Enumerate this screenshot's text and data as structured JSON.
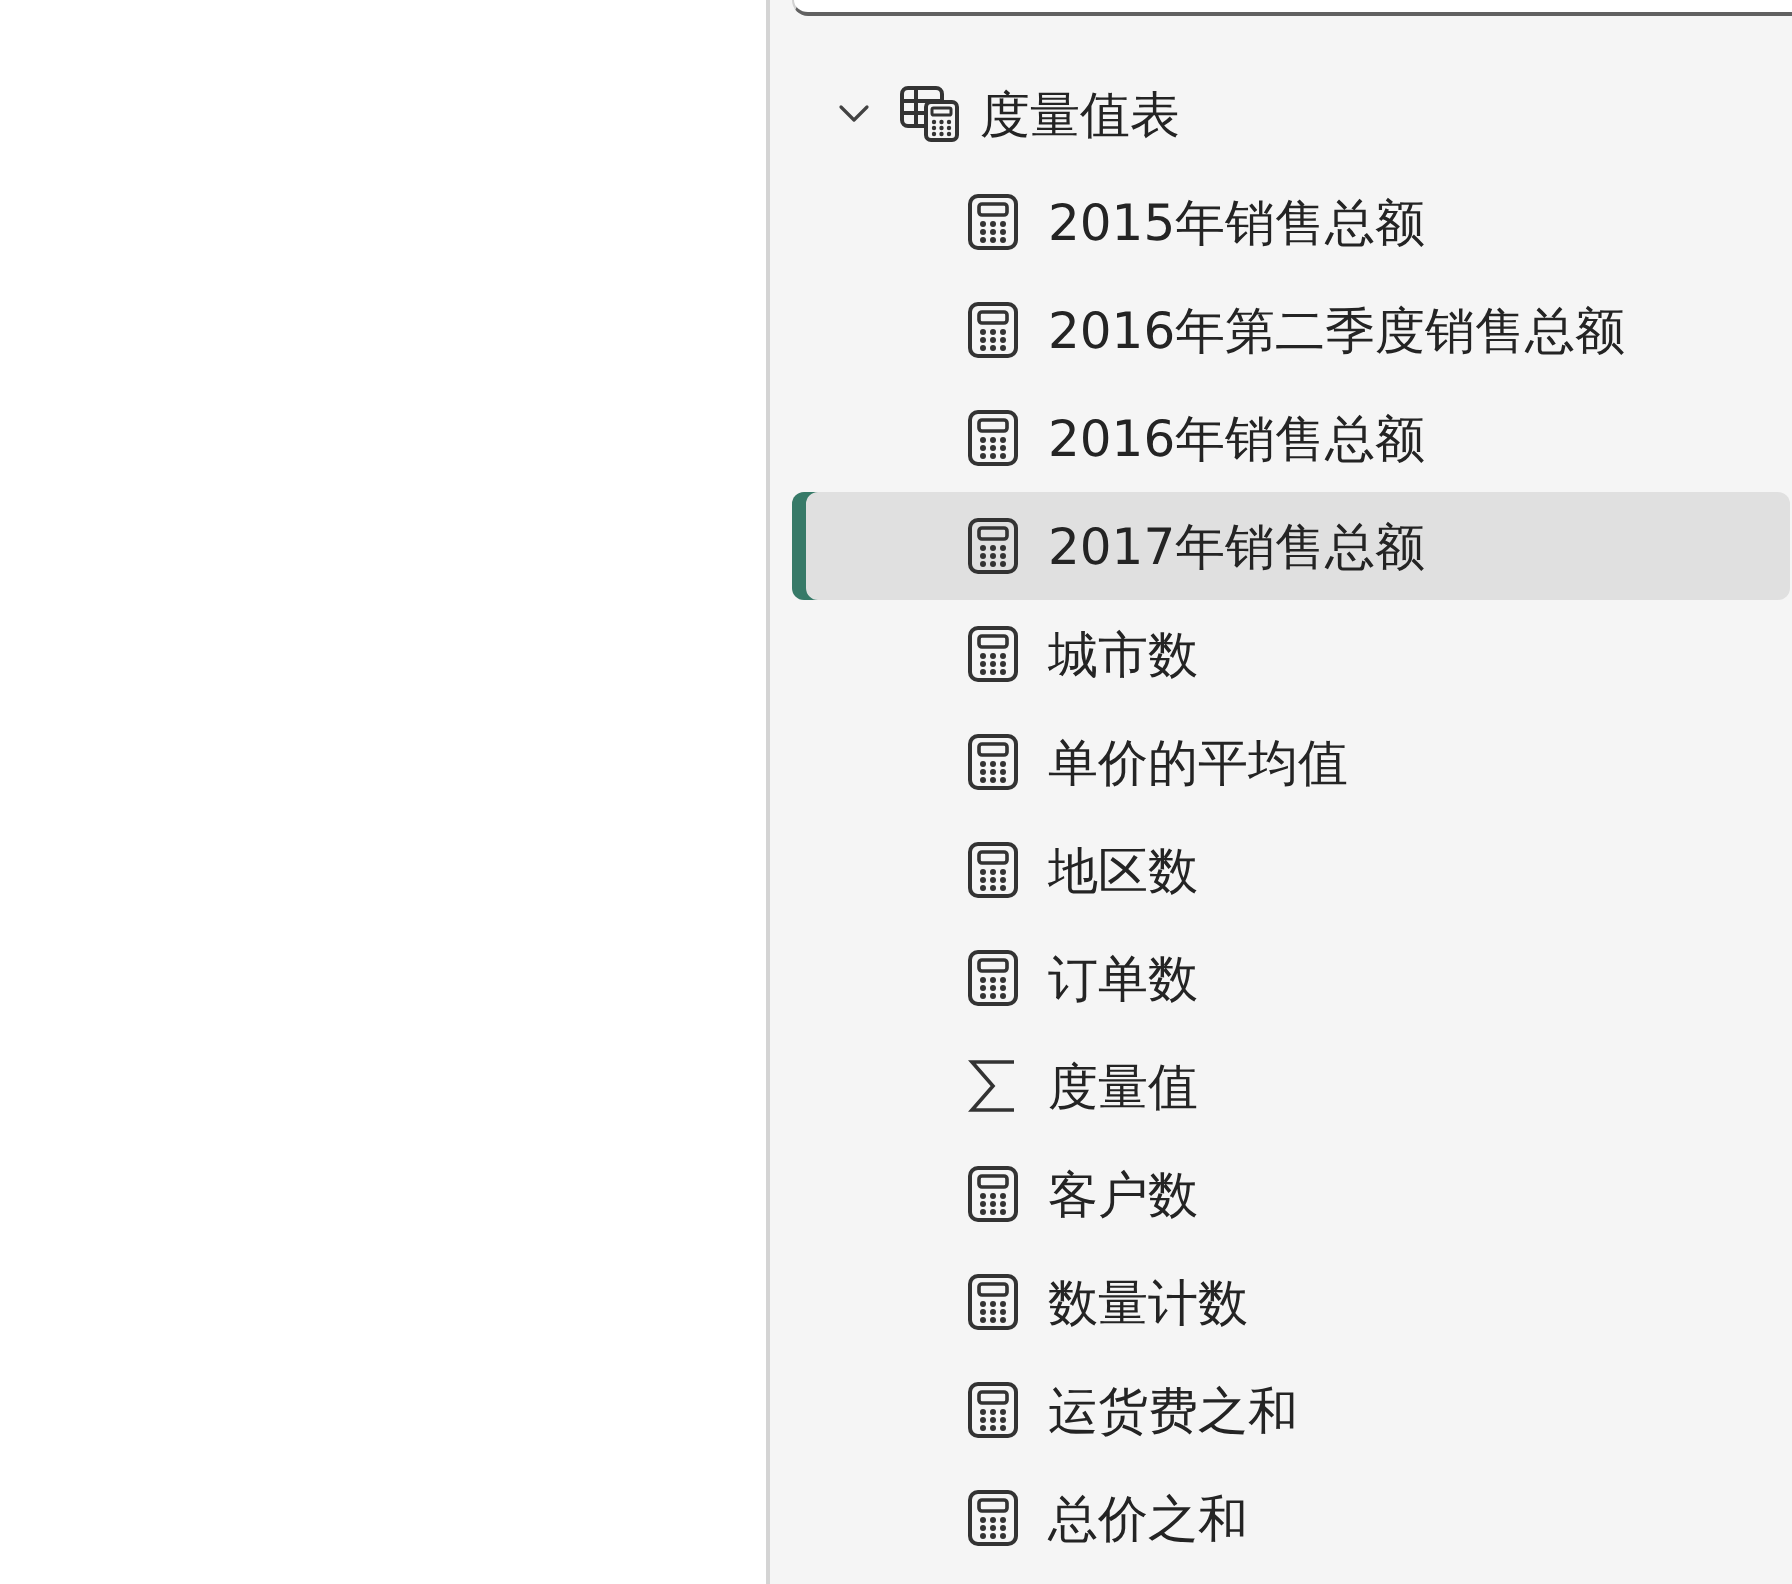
{
  "tree": {
    "label": "度量值表",
    "expanded": true,
    "children": [
      {
        "label": "2015年销售总额",
        "kind": "measure",
        "selected": false
      },
      {
        "label": "2016年第二季度销售总额",
        "kind": "measure",
        "selected": false
      },
      {
        "label": "2016年销售总额",
        "kind": "measure",
        "selected": false
      },
      {
        "label": "2017年销售总额",
        "kind": "measure",
        "selected": true
      },
      {
        "label": "城市数",
        "kind": "measure",
        "selected": false
      },
      {
        "label": "单价的平均值",
        "kind": "measure",
        "selected": false
      },
      {
        "label": "地区数",
        "kind": "measure",
        "selected": false
      },
      {
        "label": "订单数",
        "kind": "measure",
        "selected": false
      },
      {
        "label": "度量值",
        "kind": "sum",
        "selected": false
      },
      {
        "label": "客户数",
        "kind": "measure",
        "selected": false
      },
      {
        "label": "数量计数",
        "kind": "measure",
        "selected": false
      },
      {
        "label": "运货费之和",
        "kind": "measure",
        "selected": false
      },
      {
        "label": "总价之和",
        "kind": "measure",
        "selected": false
      }
    ]
  }
}
